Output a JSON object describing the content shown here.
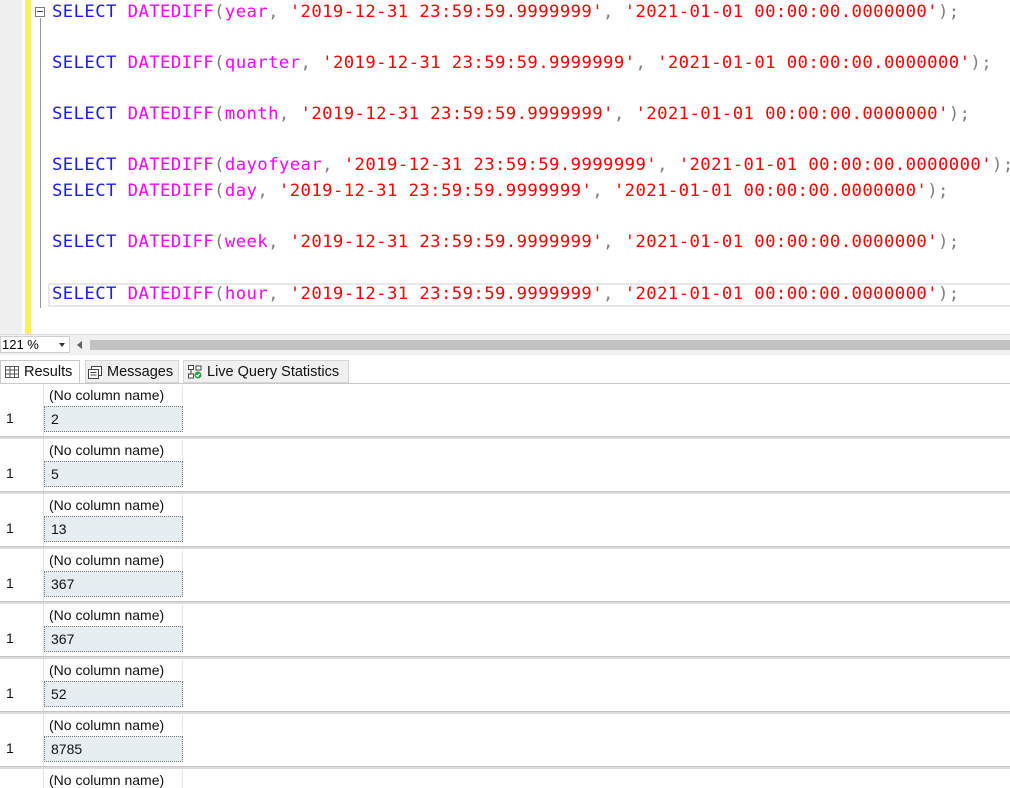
{
  "editor": {
    "lines": [
      {
        "kw": "SELECT",
        "fn": "DATEDIFF",
        "arg": "year",
        "start": "'2019-12-31 23:59:59.9999999'",
        "end": "'2021-01-01 00:00:00.0000000'"
      },
      {
        "kw": "SELECT",
        "fn": "DATEDIFF",
        "arg": "quarter",
        "start": "'2019-12-31 23:59:59.9999999'",
        "end": "'2021-01-01 00:00:00.0000000'"
      },
      {
        "kw": "SELECT",
        "fn": "DATEDIFF",
        "arg": "month",
        "start": "'2019-12-31 23:59:59.9999999'",
        "end": "'2021-01-01 00:00:00.0000000'"
      },
      {
        "kw": "SELECT",
        "fn": "DATEDIFF",
        "arg": "dayofyear",
        "start": "'2019-12-31 23:59:59.9999999'",
        "end": "'2021-01-01 00:00:00.0000000'"
      },
      {
        "kw": "SELECT",
        "fn": "DATEDIFF",
        "arg": "day",
        "start": "'2019-12-31 23:59:59.9999999'",
        "end": "'2021-01-01 00:00:00.0000000'"
      },
      {
        "kw": "SELECT",
        "fn": "DATEDIFF",
        "arg": "week",
        "start": "'2019-12-31 23:59:59.9999999'",
        "end": "'2021-01-01 00:00:00.0000000'"
      },
      {
        "kw": "SELECT",
        "fn": "DATEDIFF",
        "arg": "hour",
        "start": "'2019-12-31 23:59:59.9999999'",
        "end": "'2021-01-01 00:00:00.0000000'"
      }
    ]
  },
  "zoom": {
    "value": "121 %"
  },
  "tabs": {
    "results": "Results",
    "messages": "Messages",
    "live": "Live Query Statistics"
  },
  "results": [
    {
      "header": "(No column name)",
      "row": "1",
      "value": "2"
    },
    {
      "header": "(No column name)",
      "row": "1",
      "value": "5"
    },
    {
      "header": "(No column name)",
      "row": "1",
      "value": "13"
    },
    {
      "header": "(No column name)",
      "row": "1",
      "value": "367"
    },
    {
      "header": "(No column name)",
      "row": "1",
      "value": "367"
    },
    {
      "header": "(No column name)",
      "row": "1",
      "value": "52"
    },
    {
      "header": "(No column name)",
      "row": "1",
      "value": "8785"
    },
    {
      "header": "(No column name)",
      "row": "",
      "value": ""
    }
  ],
  "colors": {
    "keyword": "#1a1aff",
    "function": "#ff00ff",
    "string": "#ff0000",
    "punct": "#808080",
    "cell_bg": "#e6eef2"
  }
}
